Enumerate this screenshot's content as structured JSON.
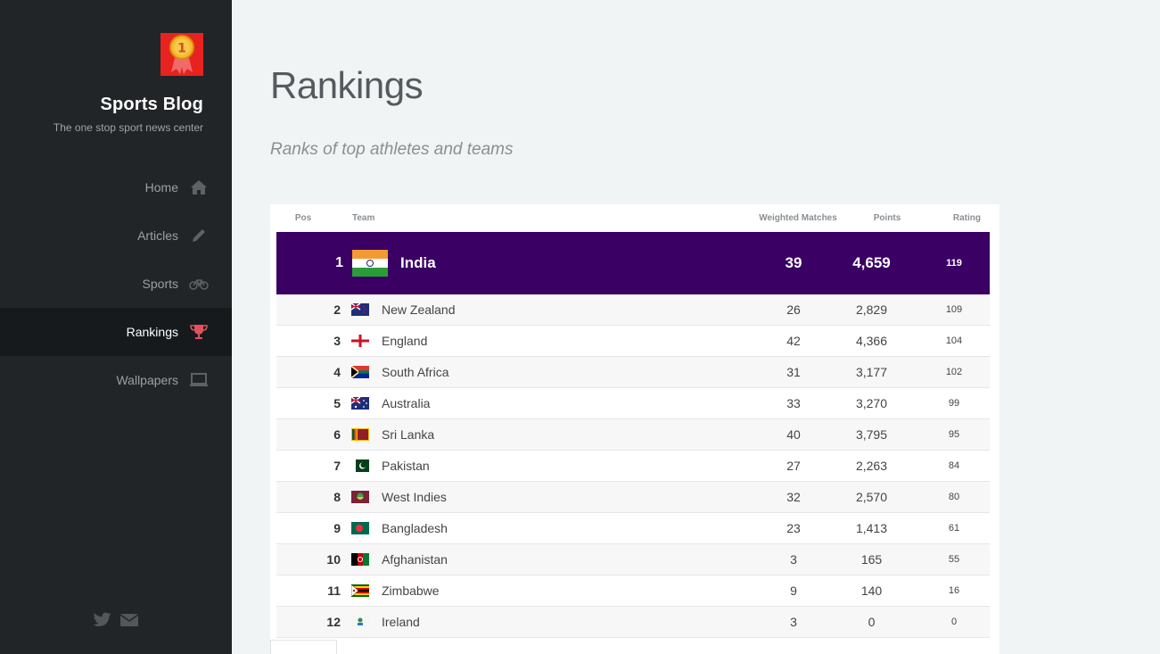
{
  "site": {
    "title": "Sports Blog",
    "tagline": "The one stop sport news center",
    "logo_icon": "medal-icon",
    "logo_text": "1"
  },
  "nav": [
    {
      "label": "Home",
      "icon": "home-icon",
      "active": false
    },
    {
      "label": "Articles",
      "icon": "pencil-icon",
      "active": false
    },
    {
      "label": "Sports",
      "icon": "bicycle-icon",
      "active": false
    },
    {
      "label": "Rankings",
      "icon": "trophy-icon",
      "active": true
    },
    {
      "label": "Wallpapers",
      "icon": "laptop-icon",
      "active": false
    }
  ],
  "social": [
    "twitter-icon",
    "envelope-icon"
  ],
  "page": {
    "title": "Rankings",
    "subtitle": "Ranks of top athletes and teams"
  },
  "table": {
    "headers": {
      "pos": "Pos",
      "team": "Team",
      "weighted_matches": "Weighted Matches",
      "points": "Points",
      "rating": "Rating"
    },
    "top": {
      "pos": "1",
      "team": "India",
      "flag": "india",
      "wm": "39",
      "pts": "4,659",
      "rating": "119"
    },
    "rows": [
      {
        "pos": "2",
        "team": "New Zealand",
        "flag": "newzealand",
        "wm": "26",
        "pts": "2,829",
        "rating": "109"
      },
      {
        "pos": "3",
        "team": "England",
        "flag": "england",
        "wm": "42",
        "pts": "4,366",
        "rating": "104"
      },
      {
        "pos": "4",
        "team": "South Africa",
        "flag": "southafrica",
        "wm": "31",
        "pts": "3,177",
        "rating": "102"
      },
      {
        "pos": "5",
        "team": "Australia",
        "flag": "australia",
        "wm": "33",
        "pts": "3,270",
        "rating": "99"
      },
      {
        "pos": "6",
        "team": "Sri Lanka",
        "flag": "srilanka",
        "wm": "40",
        "pts": "3,795",
        "rating": "95"
      },
      {
        "pos": "7",
        "team": "Pakistan",
        "flag": "pakistan",
        "wm": "27",
        "pts": "2,263",
        "rating": "84"
      },
      {
        "pos": "8",
        "team": "West Indies",
        "flag": "westindies",
        "wm": "32",
        "pts": "2,570",
        "rating": "80"
      },
      {
        "pos": "9",
        "team": "Bangladesh",
        "flag": "bangladesh",
        "wm": "23",
        "pts": "1,413",
        "rating": "61"
      },
      {
        "pos": "10",
        "team": "Afghanistan",
        "flag": "afghanistan",
        "wm": "3",
        "pts": "165",
        "rating": "55"
      },
      {
        "pos": "11",
        "team": "Zimbabwe",
        "flag": "zimbabwe",
        "wm": "9",
        "pts": "140",
        "rating": "16"
      },
      {
        "pos": "12",
        "team": "Ireland",
        "flag": "ireland",
        "wm": "3",
        "pts": "0",
        "rating": "0"
      }
    ]
  },
  "colors": {
    "sidebar_bg": "#212528",
    "active_nav_bg": "#171a1c",
    "top_row_bg": "#3a0064",
    "trophy_accent": "#e0525c"
  }
}
